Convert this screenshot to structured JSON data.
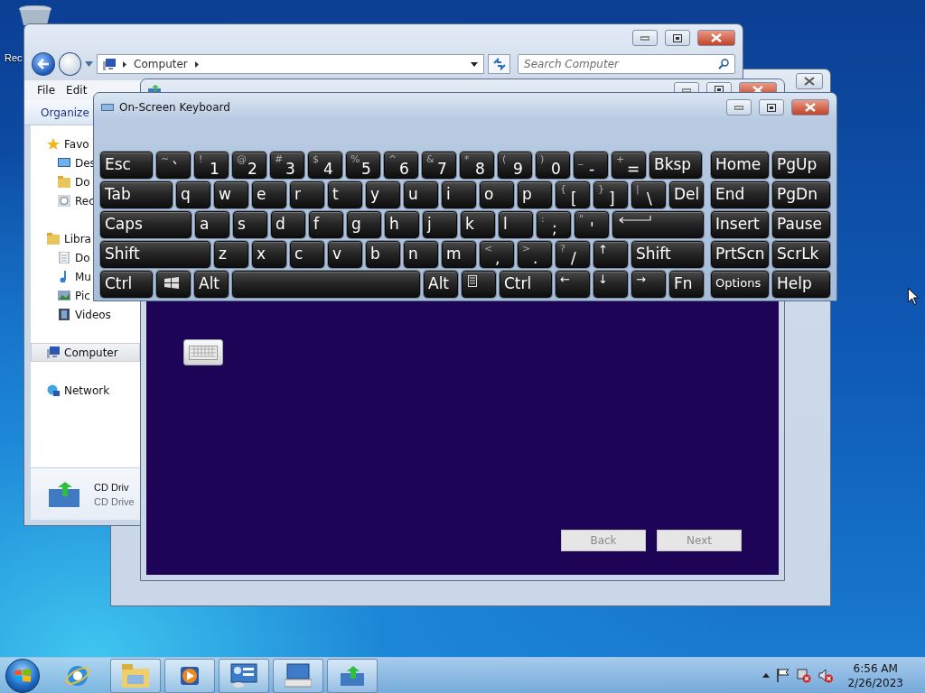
{
  "desktop": {
    "icon_label": "Rec"
  },
  "explorer": {
    "breadcrumb": "Computer",
    "search": {
      "placeholder": "Search Computer"
    },
    "menu": [
      "File",
      "Edit"
    ],
    "toolbar": [
      "Organize"
    ],
    "nav": [
      {
        "label": "Favo",
        "selected": false,
        "children": [
          {
            "label": "Des",
            "selected": false
          },
          {
            "label": "Do",
            "selected": false
          },
          {
            "label": "Rec",
            "selected": false
          }
        ]
      },
      {
        "label": "Libra",
        "selected": false,
        "children": [
          {
            "label": "Do",
            "selected": false
          },
          {
            "label": "Mu",
            "selected": false
          },
          {
            "label": "Pic",
            "selected": false
          },
          {
            "label": "Videos",
            "selected": false
          }
        ]
      },
      {
        "label": "Computer",
        "selected": true
      },
      {
        "label": "Network",
        "selected": false
      }
    ],
    "details": {
      "title": "CD Driv",
      "subtitle": "CD Drive"
    }
  },
  "setup": {
    "buttons": [
      {
        "label": "Back",
        "disabled": true
      },
      {
        "label": "Next",
        "disabled": true
      }
    ]
  },
  "osk": {
    "title": "On-Screen Keyboard",
    "rows": [
      {
        "keys": [
          {
            "kind": "label",
            "label": "Esc"
          },
          {
            "kind": "dual",
            "upper": "~",
            "lower": "`"
          },
          {
            "kind": "dual",
            "upper": "!",
            "lower": "1"
          },
          {
            "kind": "dual",
            "upper": "@",
            "lower": "2"
          },
          {
            "kind": "dual",
            "upper": "#",
            "lower": "3"
          },
          {
            "kind": "dual",
            "upper": "$",
            "lower": "4"
          },
          {
            "kind": "dual",
            "upper": "%",
            "lower": "5"
          },
          {
            "kind": "dual",
            "upper": "^",
            "lower": "6"
          },
          {
            "kind": "dual",
            "upper": "&",
            "lower": "7"
          },
          {
            "kind": "dual",
            "upper": "*",
            "lower": "8"
          },
          {
            "kind": "dual",
            "upper": "(",
            "lower": "9"
          },
          {
            "kind": "dual",
            "upper": ")",
            "lower": "0"
          },
          {
            "kind": "dual",
            "upper": "_",
            "lower": "-"
          },
          {
            "kind": "dual",
            "upper": "+",
            "lower": "="
          },
          {
            "kind": "label",
            "label": "Bksp"
          }
        ]
      },
      {
        "keys": [
          {
            "kind": "label",
            "label": "Tab"
          },
          {
            "kind": "label",
            "label": "q"
          },
          {
            "kind": "label",
            "label": "w"
          },
          {
            "kind": "label",
            "label": "e"
          },
          {
            "kind": "label",
            "label": "r"
          },
          {
            "kind": "label",
            "label": "t"
          },
          {
            "kind": "label",
            "label": "y"
          },
          {
            "kind": "label",
            "label": "u"
          },
          {
            "kind": "label",
            "label": "i"
          },
          {
            "kind": "label",
            "label": "o"
          },
          {
            "kind": "label",
            "label": "p"
          },
          {
            "kind": "dual",
            "upper": "{",
            "lower": "["
          },
          {
            "kind": "dual",
            "upper": "}",
            "lower": "]"
          },
          {
            "kind": "dual",
            "upper": "|",
            "lower": "\\"
          },
          {
            "kind": "label",
            "label": "Del"
          }
        ]
      },
      {
        "keys": [
          {
            "kind": "label",
            "label": "Caps"
          },
          {
            "kind": "label",
            "label": "a"
          },
          {
            "kind": "label",
            "label": "s"
          },
          {
            "kind": "label",
            "label": "d"
          },
          {
            "kind": "label",
            "label": "f"
          },
          {
            "kind": "label",
            "label": "g"
          },
          {
            "kind": "label",
            "label": "h"
          },
          {
            "kind": "label",
            "label": "j"
          },
          {
            "kind": "label",
            "label": "k"
          },
          {
            "kind": "label",
            "label": "l"
          },
          {
            "kind": "dual",
            "upper": ":",
            "lower": ";"
          },
          {
            "kind": "dual",
            "upper": "\"",
            "lower": "'"
          },
          {
            "kind": "enter"
          }
        ]
      },
      {
        "keys": [
          {
            "kind": "label",
            "label": "Shift"
          },
          {
            "kind": "label",
            "label": "z"
          },
          {
            "kind": "label",
            "label": "x"
          },
          {
            "kind": "label",
            "label": "c"
          },
          {
            "kind": "label",
            "label": "v"
          },
          {
            "kind": "label",
            "label": "b"
          },
          {
            "kind": "label",
            "label": "n"
          },
          {
            "kind": "label",
            "label": "m"
          },
          {
            "kind": "dual",
            "upper": "<",
            "lower": ","
          },
          {
            "kind": "dual",
            "upper": ">",
            "lower": "."
          },
          {
            "kind": "dual",
            "upper": "?",
            "lower": "/"
          },
          {
            "kind": "arrow",
            "label": "↑"
          },
          {
            "kind": "label",
            "label": "Shift"
          }
        ]
      },
      {
        "keys": [
          {
            "kind": "label",
            "label": "Ctrl"
          },
          {
            "kind": "windows"
          },
          {
            "kind": "label",
            "label": "Alt"
          },
          {
            "kind": "space"
          },
          {
            "kind": "label",
            "label": "Alt"
          },
          {
            "kind": "menu"
          },
          {
            "kind": "label",
            "label": "Ctrl"
          },
          {
            "kind": "arrow",
            "label": "←"
          },
          {
            "kind": "arrow",
            "label": "↓"
          },
          {
            "kind": "arrow",
            "label": "→"
          },
          {
            "kind": "label",
            "label": "Fn"
          }
        ]
      }
    ],
    "side": [
      {
        "kind": "label",
        "label": "Home"
      },
      {
        "kind": "label",
        "label": "PgUp"
      },
      {
        "kind": "label",
        "label": "End"
      },
      {
        "kind": "label",
        "label": "PgDn"
      },
      {
        "kind": "label",
        "label": "Insert"
      },
      {
        "kind": "label",
        "label": "Pause"
      },
      {
        "kind": "label",
        "label": "PrtScn"
      },
      {
        "kind": "label",
        "label": "ScrLk"
      },
      {
        "kind": "small",
        "label": "Options"
      },
      {
        "kind": "label",
        "label": "Help"
      }
    ]
  },
  "taskbar": {
    "time": "6:56 AM",
    "date": "2/26/2023"
  }
}
